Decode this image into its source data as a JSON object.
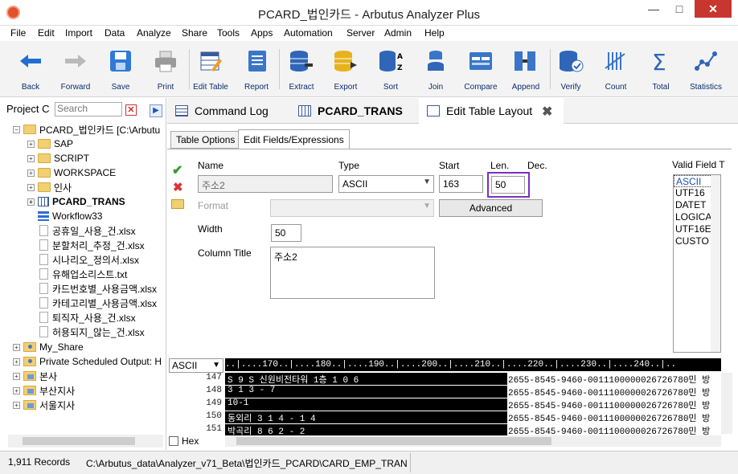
{
  "window": {
    "title": "PCARD_법인카드 - Arbutus Analyzer Plus",
    "min": "—",
    "max": "□",
    "close": "✕"
  },
  "menu": [
    "File",
    "Edit",
    "Import",
    "Data",
    "Analyze",
    "Share",
    "Tools",
    "Apps",
    "Automation",
    "Server",
    "Admin",
    "Help"
  ],
  "toolbar": [
    "Back",
    "Forward",
    "Save",
    "Print",
    "Edit Table",
    "Report",
    "Extract",
    "Export",
    "Sort",
    "Join",
    "Compare",
    "Append",
    "Verify",
    "Count",
    "Total",
    "Statistics"
  ],
  "project": {
    "header": "Project C",
    "search_placeholder": "Search",
    "root": "PCARD_법인카드 [C:\\Arbutu",
    "items": [
      "SAP",
      "SCRIPT",
      "WORKSPACE",
      "인사",
      "PCARD_TRANS",
      "Workflow33",
      "공휴일_사용_건.xlsx",
      "분할처리_추정_건.xlsx",
      "시나리오_정의서.xlsx",
      "유해업소리스트.txt",
      "카드번호별_사용금액.xlsx",
      "카테고리별_사용금액.xlsx",
      "퇴직자_사용_건.xlsx",
      "허용되지_않는_건.xlsx"
    ],
    "others": [
      "My_Share",
      "Private Scheduled Output: H",
      "본사",
      "부산지사",
      "서울지사"
    ]
  },
  "tabs": [
    {
      "label": "Command Log"
    },
    {
      "label": "PCARD_TRANS"
    },
    {
      "label": "Edit Table Layout"
    }
  ],
  "tab_close": "✖",
  "subtabs": [
    "Table Options",
    "Edit Fields/Expressions"
  ],
  "form": {
    "name_label": "Name",
    "name_value": "주소2",
    "type_label": "Type",
    "type_value": "ASCII",
    "start_label": "Start",
    "start_value": "163",
    "len_label": "Len.",
    "len_value": "50",
    "dec_label": "Dec.",
    "format_label": "Format",
    "format_value": "",
    "advanced": "Advanced",
    "width_label": "Width",
    "width_value": "50",
    "coltitle_label": "Column Title",
    "coltitle_value": "주소2",
    "valid_label": "Valid Field T",
    "valid_types": [
      "ASCII",
      "UTF16",
      "DATET",
      "LOGICA",
      "UTF16E",
      "CUSTO"
    ]
  },
  "grid": {
    "type": "ASCII",
    "ruler": "..|....170..|....180..|....190..|....200..|....210..|....220..|....230..|....240..|..",
    "rows": [
      {
        "n": "147",
        "sel": "S 9 S  신원비전타워  1층  1 0 6",
        "rest": "2655-8545-9460-0011100000026726780민 방"
      },
      {
        "n": "148",
        "sel": "3 1 3 - 7",
        "rest": "2655-8545-9460-0011100000026726780민 방"
      },
      {
        "n": "149",
        "sel": "10-1",
        "rest": "2655-8545-9460-0011100000026726780민 방"
      },
      {
        "n": "150",
        "sel": "동외리  3 1 4 - 1 4",
        "rest": "2655-8545-9460-0011100000026726780민 방"
      },
      {
        "n": "151",
        "sel": "박곡리  8 6 2 - 2",
        "rest": "2655-8545-9460-0011100000026726780민 방"
      }
    ],
    "hex": "Hex"
  },
  "status": {
    "records": "1,911 Records",
    "path": "C:\\Arbutus_data\\Analyzer_v71_Beta\\법인카드_PCARD\\CARD_EMP_TRAN"
  }
}
